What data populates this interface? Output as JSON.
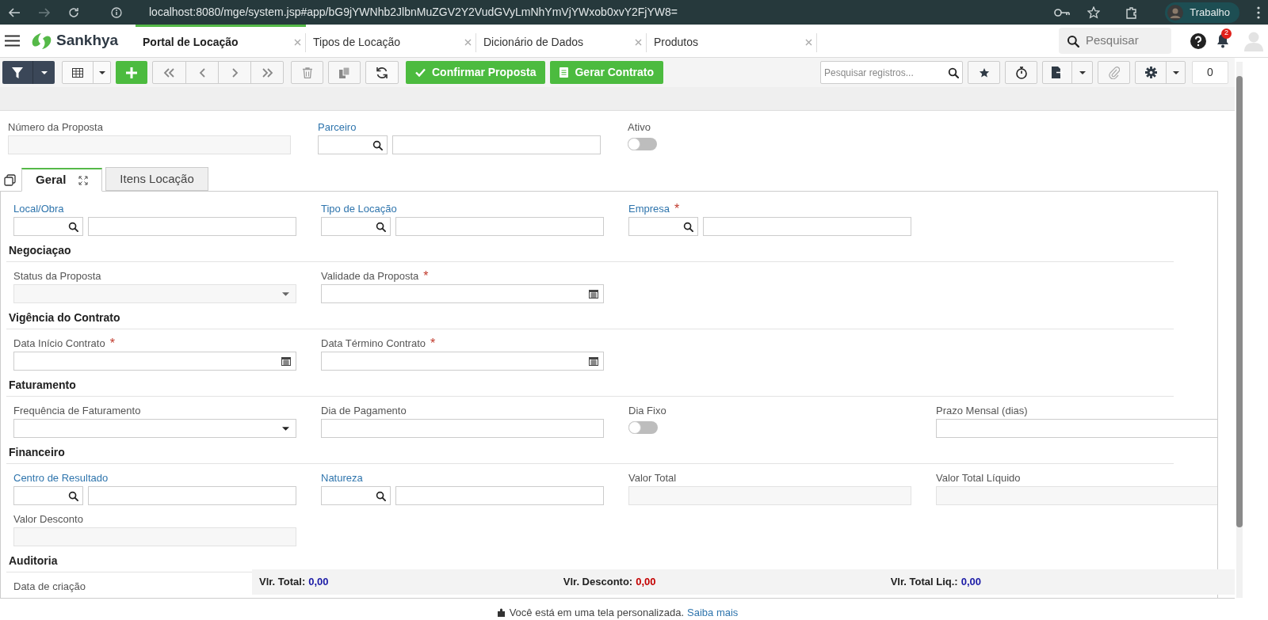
{
  "browser": {
    "url": "localhost:8080/mge/system.jsp#app/bG9jYWNhb2JlbnMuZGV2Y2VudGVyLmNhYmVjYWxob0xvY2FjYW8=",
    "profile": "Trabalho"
  },
  "app": {
    "brand": "Sankhya",
    "search_placeholder": "Pesquisar",
    "notification_count": "2"
  },
  "tabs": [
    {
      "label": "Portal de Locação",
      "selected": true
    },
    {
      "label": "Tipos de Locação",
      "selected": false
    },
    {
      "label": "Dicionário de Dados",
      "selected": false
    },
    {
      "label": "Produtos",
      "selected": false
    }
  ],
  "toolbar": {
    "primary_actions": [
      "Confirmar Proposta",
      "Gerar Contrato"
    ],
    "search_placeholder": "Pesquisar registros...",
    "count": "0"
  },
  "header_fields": [
    {
      "label": "Número da Proposta",
      "kind": "text",
      "disabled": true
    },
    {
      "label": "Parceiro",
      "kind": "lookup",
      "link": true
    },
    {
      "label": "Ativo",
      "kind": "toggle",
      "on": false
    }
  ],
  "form_tabs": [
    {
      "label": "Geral",
      "selected": true
    },
    {
      "label": "Itens Locação",
      "selected": false
    }
  ],
  "sections": [
    {
      "fields": [
        {
          "label": "Local/Obra",
          "kind": "lookup",
          "link": true
        },
        {
          "label": "Tipo de Locação",
          "kind": "lookup",
          "link": true
        },
        {
          "label": "Empresa",
          "kind": "lookup",
          "link": true,
          "required_mark": "*"
        }
      ]
    },
    {
      "title": "Negociaçao",
      "fields": [
        {
          "label": "Status da Proposta",
          "kind": "select",
          "disabled": true
        },
        {
          "label": "Validade da Proposta",
          "kind": "date",
          "required_mark": "*"
        }
      ]
    },
    {
      "title": "Vigência do Contrato",
      "fields": [
        {
          "label": "Data Início Contrato",
          "kind": "date",
          "required_mark": "*"
        },
        {
          "label": "Data Término Contrato",
          "kind": "date",
          "required_mark": "*"
        }
      ]
    },
    {
      "title": "Faturamento",
      "fields": [
        {
          "label": "Frequência de Faturamento",
          "kind": "select",
          "disabled": false
        },
        {
          "label": "Dia de Pagamento",
          "kind": "text",
          "disabled": false
        },
        {
          "label": "Dia Fixo",
          "kind": "toggle",
          "on": false
        },
        {
          "label": "Prazo Mensal (dias)",
          "kind": "text",
          "disabled": false
        }
      ]
    },
    {
      "title": "Financeiro",
      "fields": [
        {
          "label": "Centro de Resultado",
          "kind": "lookup",
          "link": true
        },
        {
          "label": "Natureza",
          "kind": "lookup",
          "link": true
        },
        {
          "label": "Valor Total",
          "kind": "text",
          "disabled": true
        },
        {
          "label": "Valor Total Líquido",
          "kind": "text",
          "disabled": true
        },
        {
          "label": "Valor Desconto",
          "kind": "text",
          "disabled": true
        }
      ]
    },
    {
      "title": "Auditoria",
      "fields": [
        {
          "label": "Data de criação"
        }
      ]
    }
  ],
  "totals": [
    {
      "label": "Vlr. Total:",
      "value": "0,00",
      "color": "#1a1aa6"
    },
    {
      "label": "Vlr. Desconto:",
      "value": "0,00",
      "color": "#c40000"
    },
    {
      "label": "Vlr. Total Liq.:",
      "value": "0,00",
      "color": "#1a1aa6"
    }
  ],
  "footer": {
    "text": "Você está em uma tela personalizada.",
    "link": "Saiba mais"
  }
}
